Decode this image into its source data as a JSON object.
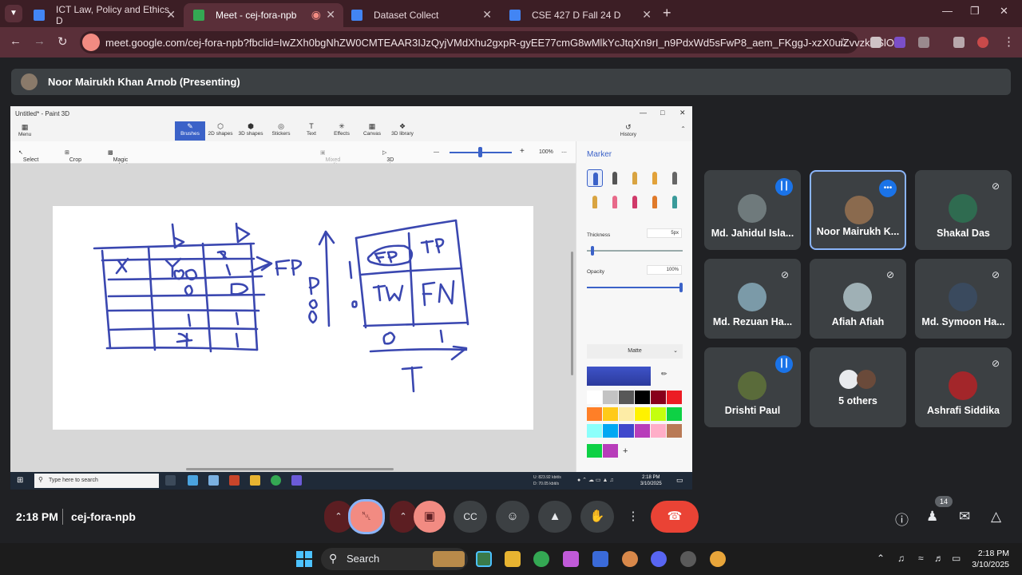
{
  "browser": {
    "tabs": [
      {
        "label": "ICT Law, Policy and Ethics D",
        "color": "#4285f4"
      },
      {
        "label": "Meet - cej-fora-npb",
        "color": "#34a853",
        "active": true
      },
      {
        "label": "Dataset Collect",
        "color": "#4285f4"
      },
      {
        "label": "CSE 427 D Fall 24 D",
        "color": "#4285f4"
      }
    ],
    "url": "meet.google.com/cej-fora-npb?fbclid=IwZXh0bgNhZW0CMTEAAR3IJzQyjVMdXhu2gxpR-gyEE77cmG8wMlkYcJtqXn9rI_n9PdxWd5sFwP8_aem_FKggJ-xzX0uiZvvzkXSlOw"
  },
  "presenter": {
    "label": "Noor Mairukh Khan Arnob (Presenting)"
  },
  "paint3d": {
    "window_title": "Untitled* - Paint 3D",
    "menu_label": "Menu",
    "tools": [
      "Brushes",
      "2D shapes",
      "3D shapes",
      "Stickers",
      "Text",
      "Effects",
      "Canvas",
      "3D library"
    ],
    "history_label": "History",
    "sub_tools": {
      "select": "Select",
      "crop": "Crop",
      "magic": "Magic select",
      "mixed": "Mixed reality",
      "view3d": "3D view",
      "zoom": "100%"
    },
    "panel": {
      "title": "Marker",
      "thickness_label": "Thickness",
      "thickness_value": "5px",
      "opacity_label": "Opacity",
      "opacity_value": "100%",
      "finish": "Matte",
      "accent": "#3b62c8",
      "swatches": [
        "#ffffff",
        "#c3c3c3",
        "#585858",
        "#000000",
        "#88001b",
        "#ec1c24",
        "#ff7f27",
        "#ffca18",
        "#fdeca6",
        "#fff200",
        "#c4ff0e",
        "#0ed145",
        "#8cfffb",
        "#00a8f3",
        "#3f48cc",
        "#b83dba",
        "#ffaec8",
        "#b97a56",
        "#0ed145",
        "#b83dba"
      ]
    },
    "taskbar": {
      "search": "Type here to search",
      "time": "2:18 PM",
      "date": "3/10/2025",
      "net_up": "U:   823.92 kbit/s",
      "net_down": "D:   70.05 kbit/s"
    }
  },
  "participants": [
    {
      "name": "Md. Jahidul Isla...",
      "state": "speaking",
      "avatar": "#6f7a7c"
    },
    {
      "name": "Noor Mairukh K...",
      "state": "more",
      "avatar": "#8a6a4e",
      "highlight": true
    },
    {
      "name": "Shakal Das",
      "state": "muted",
      "avatar": "#2f6b50"
    },
    {
      "name": "Md. Rezuan Ha...",
      "state": "muted",
      "avatar": "#7b9aa8"
    },
    {
      "name": "Afiah Afiah",
      "state": "muted",
      "avatar": "#9fb0b5"
    },
    {
      "name": "Md. Symoon Ha...",
      "state": "muted",
      "avatar": "#3a4a5e"
    },
    {
      "name": "Drishti Paul",
      "state": "speaking",
      "avatar": "#5a6b3a"
    },
    {
      "name": "5 others",
      "state": "none",
      "avatar": "#e8eaed"
    },
    {
      "name": "Ashrafi Siddika",
      "state": "muted",
      "avatar": "#a3262a"
    }
  ],
  "meeting": {
    "time": "2:18 PM",
    "code": "cej-fora-npb",
    "people_count": "14"
  },
  "taskbar": {
    "search": "Search",
    "time": "2:18 PM",
    "date": "3/10/2025"
  }
}
